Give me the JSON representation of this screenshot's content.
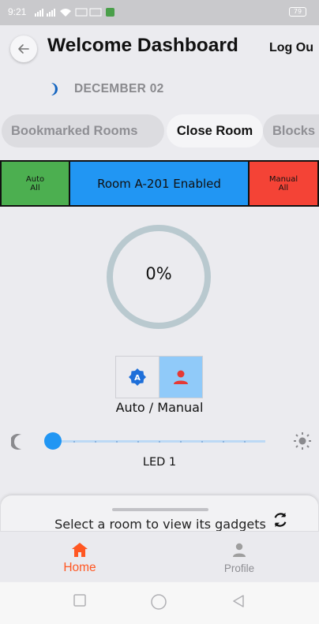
{
  "status_bar": {
    "time": "9:21",
    "icons_text": "···· ····",
    "battery": "79"
  },
  "header": {
    "title": "Welcome Dashboard",
    "logout_label": "Log Ou",
    "date": "DECEMBER 02"
  },
  "tabs": [
    {
      "label": "Bookmarked Rooms",
      "active": false
    },
    {
      "label": "Close Room",
      "active": true
    },
    {
      "label": "Blocks",
      "active": false
    }
  ],
  "control_bar": {
    "auto_label": "Auto\nAll",
    "room_label": "Room A-201 Enabled",
    "manual_label": "Manual\nAll",
    "colors": {
      "auto": "#4caf50",
      "room": "#2196f3",
      "manual": "#f44336"
    }
  },
  "progress": {
    "value_text": "0%",
    "value": 0
  },
  "mode": {
    "label": "Auto / Manual",
    "selected": "manual",
    "auto_icon": "auto-mode-icon",
    "manual_icon": "person-icon"
  },
  "slider": {
    "label": "LED 1",
    "value": 0,
    "min_icon": "moon-icon",
    "max_icon": "sun-icon"
  },
  "sheet": {
    "text": "Select a room to view its gadgets",
    "action_icon": "refresh-icon"
  },
  "bottom_nav": {
    "home_label": "Home",
    "profile_label": "Profile",
    "active": "home",
    "accent": "#ff5722"
  },
  "system_nav": {
    "icons": [
      "square-icon",
      "circle-icon",
      "triangle-back-icon"
    ]
  }
}
